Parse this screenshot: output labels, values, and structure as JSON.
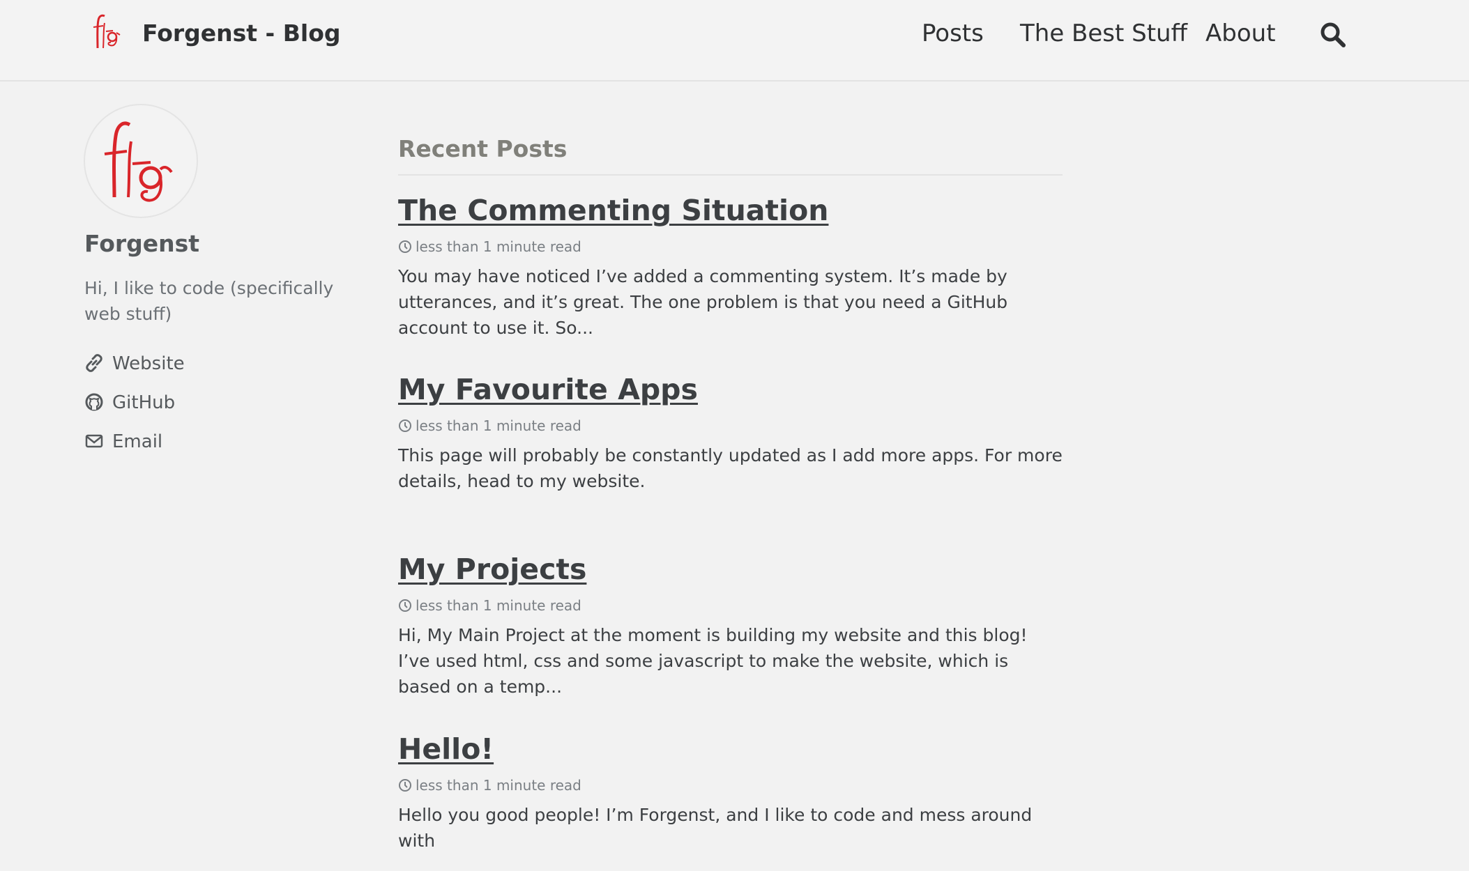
{
  "header": {
    "site_title": "Forgenst - Blog",
    "nav": {
      "posts": "Posts",
      "best_stuff": "The Best Stuff",
      "about": "About"
    }
  },
  "author": {
    "name": "Forgenst",
    "bio": "Hi, I like to code (specifically web stuff)",
    "links": {
      "website": "Website",
      "github": "GitHub",
      "email": "Email"
    }
  },
  "main": {
    "section_title": "Recent Posts",
    "posts": [
      {
        "title": "The Commenting Situation",
        "read_time": "less than 1 minute read",
        "excerpt": "You may have noticed I’ve added a commenting system. It’s made by utterances, and it’s great. The one problem is that you need a GitHub account to use it. So..."
      },
      {
        "title": "My Favourite Apps",
        "read_time": "less than 1 minute read",
        "excerpt": "This page will probably be constantly updated as I add more apps. For more details, head to my website."
      },
      {
        "title": "My Projects",
        "read_time": "less than 1 minute read",
        "excerpt": "Hi, My Main Project at the moment is building my website and this blog! I’ve used html, css and some javascript to make the website, which is based on a temp..."
      },
      {
        "title": "Hello!",
        "read_time": "less than 1 minute read",
        "excerpt": "Hello you good people! I’m Forgenst, and I like to code and mess around with"
      }
    ]
  },
  "colors": {
    "logo_red": "#d9252a",
    "background": "#f2f2f2",
    "text_dark": "#3c3f42"
  },
  "icons": {
    "logo": "fg-monogram-logo",
    "search": "search-icon",
    "website": "link-icon",
    "github": "github-icon",
    "email": "envelope-icon",
    "read_time": "clock-icon"
  }
}
